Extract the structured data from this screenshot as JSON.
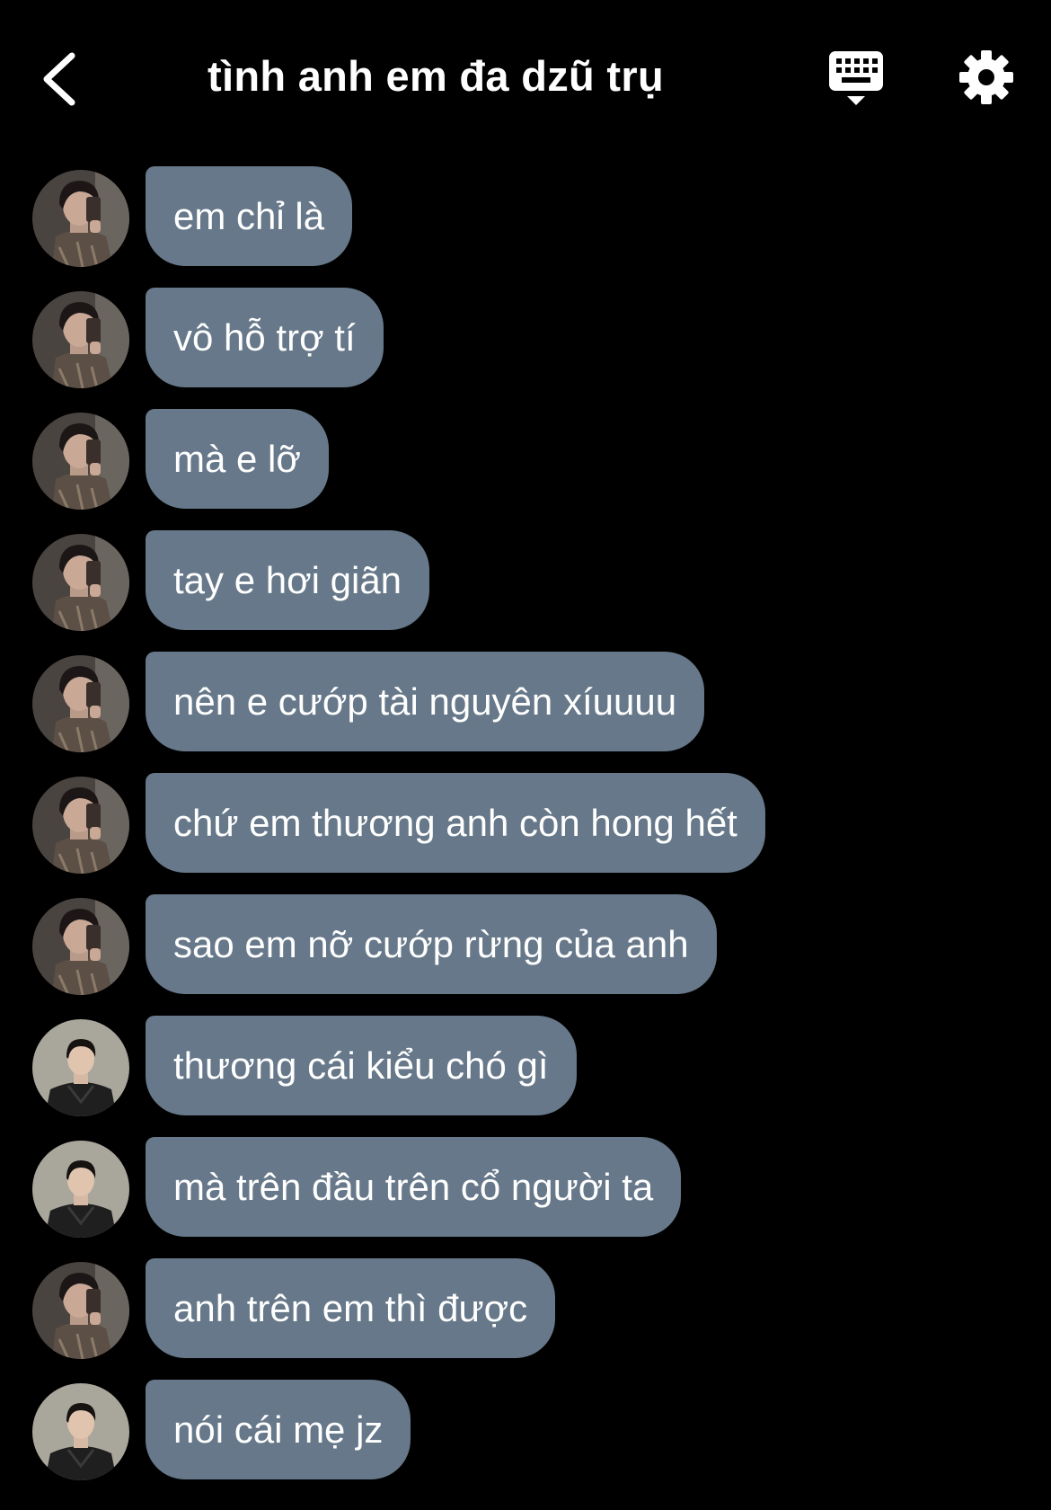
{
  "header": {
    "title": "tình anh em đa dzũ trụ",
    "back_icon": "chevron-left-icon",
    "keyboard_icon": "keyboard-hide-icon",
    "settings_icon": "gear-icon"
  },
  "colors": {
    "background": "#000000",
    "bubble": "#667889",
    "text": "#ffffff"
  },
  "messages": [
    {
      "sender": "a",
      "text": "em chỉ là"
    },
    {
      "sender": "a",
      "text": "vô hỗ trợ tí"
    },
    {
      "sender": "a",
      "text": "mà e lỡ"
    },
    {
      "sender": "a",
      "text": "tay e hơi giãn"
    },
    {
      "sender": "a",
      "text": "nên e cướp tài nguyên xíuuuu"
    },
    {
      "sender": "a",
      "text": "chứ em thương anh còn hong hết"
    },
    {
      "sender": "a",
      "text": "sao em nỡ cướp rừng của anh"
    },
    {
      "sender": "b",
      "text": "thương cái kiểu chó gì"
    },
    {
      "sender": "b",
      "text": "mà trên đầu trên cổ người ta"
    },
    {
      "sender": "a",
      "text": "anh trên em thì được"
    },
    {
      "sender": "b",
      "text": "nói cái mẹ jz"
    }
  ]
}
